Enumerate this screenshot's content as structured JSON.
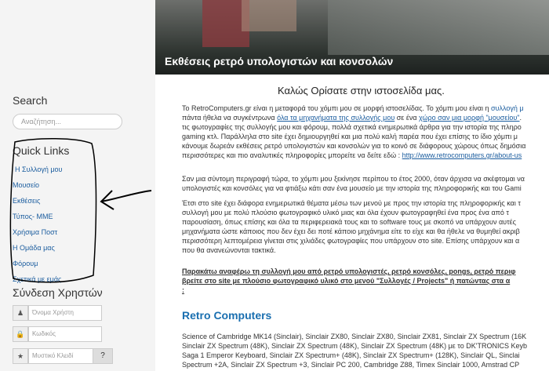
{
  "sidebar": {
    "search_title": "Search",
    "search_placeholder": "Αναζήτηση...",
    "quick_links_title": "Quick Links",
    "quick_links": [
      "Η Συλλογή μου",
      "Μουσείο",
      "Εκθέσεις",
      "Τύπος- ΜΜΕ",
      "Χρήσιμα Ποστ",
      "Η Ομάδα μας",
      "Φόρουμ",
      "Σχετικά με εμάς"
    ],
    "login_title": "Σύνδεση Χρηστών",
    "username_placeholder": "Όνομα Χρήστη",
    "password_placeholder": "Κωδικός",
    "remember_placeholder": "Μυστικό Κλειδί",
    "help_button": "?"
  },
  "main": {
    "banner_caption": "Εκθέσεις ρετρό υπολογιστών και κονσολών",
    "welcome_title": "Καλώς Ορίσατε στην ιστοσελίδα μας.",
    "p1": {
      "l1a": "Το RetroComputers.gr είναι η μεταφορά του χόμπι μου σε μορφή ιστοσελίδας. Το χόμπι μου είναι η ",
      "l1b": "συλλογή μ",
      "l2a": "πάντα ήθελα να συγκέντρωνα ",
      "l2b": "όλα τα μηχανήματα της συλλογής μου",
      "l2c": " σε ένα ",
      "l2d": "χώρο σαν μια μορφή \"μουσείου\"",
      "l2e": ".",
      "l3": "τις φωτογραφίες της συλλογής μου και φόρουμ, πολλά σχετικά ενημερωτικά άρθρα για την ιστορία της πληρο",
      "l4": "gaming κτλ. Παράλληλα στο site έχει δημιουργηθεί και μια πολύ καλή παρέα που έχει επίσης το ίδιο χόμπι μ",
      "l5": "κάνουμε δωρεάν εκθέσεις ρετρό υπολογιστών και κονσολών για το κοινό σε διάφορους χώρους όπως δημόσια",
      "l6a": "περισσότερες και πιο αναλυτικές πληροφορίες μπορείτε να δείτε εδώ : ",
      "l6b": "http://www.retrocomputers.gr/about-us"
    },
    "p2": {
      "l1": "Σαν μια σύντομη περιγραφή τώρα, το χόμπι μου ξεκίνησε περίπου το έτος 2000, όταν άρχισα να σκέφτομαι να",
      "l2": "υπολογιστές και κονσόλες για να φτιάξω κάτι σαν ένα μουσείο με την ιστορία της πληροφορικής και του Gami"
    },
    "p3": {
      "l1": "Έτσι στο site έχει διάφορα ενημερωτικά θέματα μέσω των μενού με προς την ιστορία της πληροφορικής και τ",
      "l2": "συλλογή μου με πολύ πλούσιο φωτογραφικό υλικό μιας και όλα έχουν φωτογραφηθεί ένα προς ένα από τ",
      "l3": "παρουσίαση, όπως επίσης και όλα τα περιφερειακά τους και το software τους με σκοπό να υπάρχουν αυτές",
      "l4": "μηχανήματα ώστε κάποιος που δεν έχει δει ποτέ κάποιο μηχάνημα είτε το είχε και θα ήθελε να θυμηθεί ακριβ",
      "l5": "περισσότερη λεπτομέρεια γίνεται στις χιλιάδες φωτογραφίες που υπάρχουν στο site. Επίσης υπάρχουν και α",
      "l6": "που θα ανανεώνονται τακτικά."
    },
    "p4": {
      "l1": "Παρακάτω αναφέρω τη συλλογή μου από ρετρό υπολογιστές, ρετρό κονσόλες, pongs, ρετρό περιφ",
      "l2": "βρείτε στο site με πλούσιο φωτογραφικό υλικό στο μενού \"Συλλογές / Projects\" ή πατώντας στα α",
      "l3": ":"
    },
    "rc_title": "Retro Computers",
    "rc_lines": [
      "Science of Cambridge MK14 (Sinclair), Sinclair ZX80, Sinclair ZX80, Sinclair ZX81, Sinclair ZX Spectrum (16K",
      "Sinclair ZX Spectrum (48K), Sinclair ZX Spectrum (48K), Sinclair ZX Spectrum (48K) με το DK'TRONICS Keyb",
      "Saga 1 Emperor Keyboard, Sinclair ZX Spectrum+ (48K), Sinclair ZX Spectrum+ (128K), Sinclair QL, Sinclai",
      "Spectrum +2A, Sinclair ZX Spectrum +3, Sinclair PC 200, Cambridge Z88, Timex Sinclair 1000, Amstrad CP"
    ]
  }
}
